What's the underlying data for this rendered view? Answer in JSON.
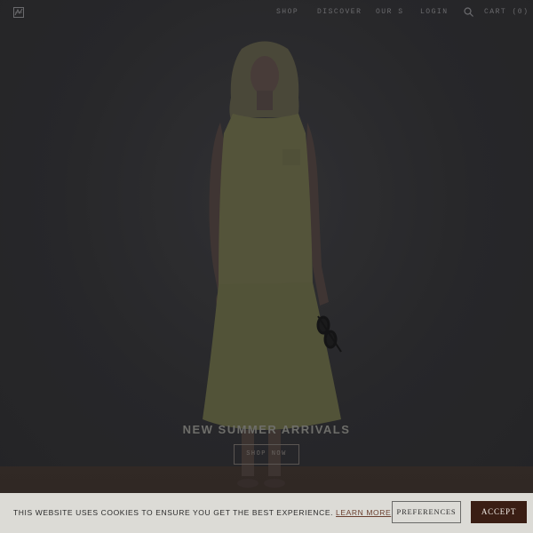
{
  "nav": {
    "logo_icon": "brand-monogram-icon",
    "links": [
      {
        "label": "SHOP"
      },
      {
        "label": "DISCOVER"
      },
      {
        "label": "OUR S"
      },
      {
        "label": "LOGIN"
      }
    ],
    "search_icon": "search-icon",
    "cart_label": "CART (0)"
  },
  "hero": {
    "title": "NEW SUMMER ARRIVALS",
    "cta_label": "SHOP NOW"
  },
  "cookie_banner": {
    "message": "THIS WEBSITE USES COOKIES TO ENSURE YOU GET THE BEST EXPERIENCE.",
    "learn_more_label": "LEARN MORE",
    "preferences_label": "PREFERENCES",
    "accept_label": "ACCEPT",
    "accent_color": "#3a1e14"
  }
}
